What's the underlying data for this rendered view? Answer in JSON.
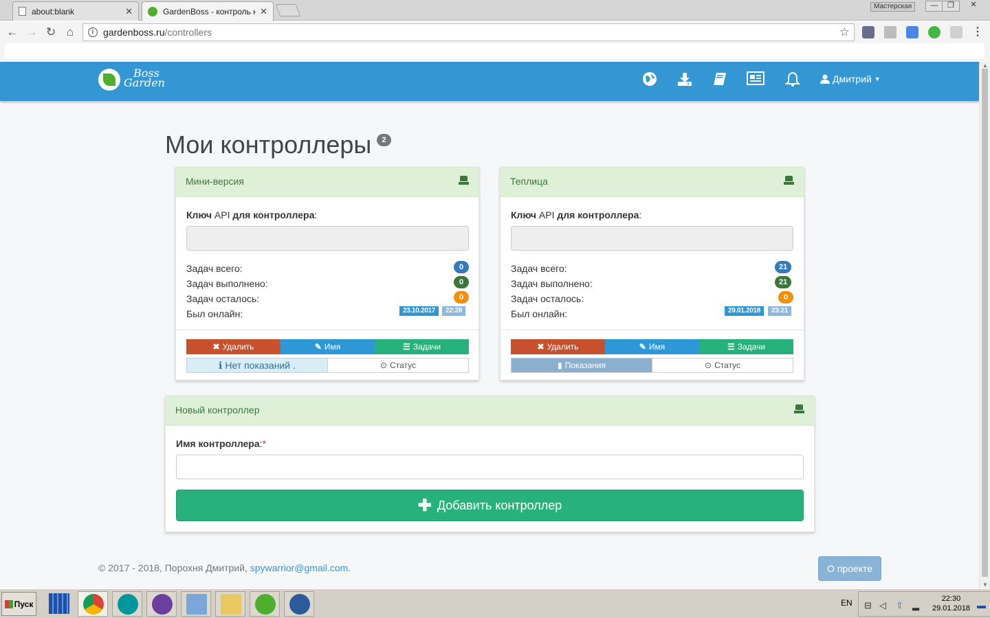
{
  "browser": {
    "tabs": [
      {
        "title": "about:blank",
        "close": "✕"
      },
      {
        "title": "GardenBoss - контроль на",
        "close": "✕"
      }
    ],
    "profile_label": "Мастерская",
    "url_host": "gardenboss.ru",
    "url_path": "/controllers"
  },
  "navbar": {
    "logo_line1": "Boss",
    "logo_line2": "Garden",
    "user_name": "Дмитрий"
  },
  "page": {
    "title": "Мои контроллеры",
    "controller_count": "2"
  },
  "controllers": [
    {
      "name": "Мини-версия",
      "api_label_bold1": "Ключ",
      "api_label_plain": "API",
      "api_label_bold2": "для контроллера",
      "api_label_colon": ":",
      "stats": [
        {
          "label": "Задач всего:",
          "value": "0",
          "color": "#337ab7"
        },
        {
          "label": "Задач выполнено:",
          "value": "0",
          "color": "#3c763d"
        },
        {
          "label": "Задач осталось:",
          "value": "0",
          "color": "#f0900e"
        }
      ],
      "online_label": "Был онлайн:",
      "online_date": "23.10.2017",
      "online_time": "22:28",
      "actions": {
        "delete": "Удалить",
        "name": "Имя",
        "tasks": "Задачи"
      },
      "readings": "Нет показаний",
      "readings_dot": ".",
      "status": "Статус"
    },
    {
      "name": "Теплица",
      "api_label_bold1": "Ключ",
      "api_label_plain": "API",
      "api_label_bold2": "для контроллера",
      "api_label_colon": ":",
      "stats": [
        {
          "label": "Задач всего:",
          "value": "21",
          "color": "#337ab7"
        },
        {
          "label": "Задач выполнено:",
          "value": "21",
          "color": "#3c763d"
        },
        {
          "label": "Задач осталось:",
          "value": "0",
          "color": "#f0900e"
        }
      ],
      "online_label": "Был онлайн:",
      "online_date": "29.01.2018",
      "online_time": "23:21",
      "actions": {
        "delete": "Удалить",
        "name": "Имя",
        "tasks": "Задачи"
      },
      "readings": "Показания",
      "status": "Статус"
    }
  ],
  "new_controller": {
    "heading": "Новый контроллер",
    "name_label": "Имя контроллера",
    "name_colon": ":",
    "required_mark": "*",
    "name_value": "",
    "add_button": "Добавить контроллер"
  },
  "footer": {
    "copyright": "© 2017 - 2018, Порохня Дмитрий,",
    "email": "spywarrior@gmail.com",
    "email_dot": ".",
    "about_button": "О проекте"
  },
  "taskbar": {
    "start_label": "Пуск",
    "language": "EN",
    "time": "22:30",
    "date": "29.01.2018"
  },
  "colors": {
    "navbar": "#3497d3",
    "panel_header": "#def0d8",
    "danger": "#c9502c",
    "info": "#2e97d7",
    "success": "#27b17d",
    "date_tag": "#2e97d7",
    "time_tag": "#8bb8de"
  },
  "icons": [
    "globe-icon",
    "download-icon",
    "book-icon",
    "newspaper-icon",
    "bell-icon",
    "user-icon",
    "hdd-icon",
    "remove-icon",
    "edit-icon",
    "tasks-list-icon",
    "info-circle-icon",
    "clock-icon",
    "bar-chart-icon",
    "plus-icon"
  ]
}
